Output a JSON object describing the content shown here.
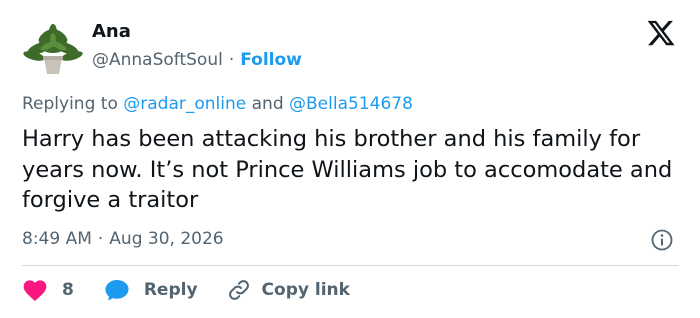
{
  "author": {
    "name": "Ana",
    "handle": "@AnnaSoftSoul",
    "separator": "·",
    "follow_label": "Follow"
  },
  "reply_context": {
    "prefix": "Replying to",
    "mention_1": "@radar_online",
    "conjunction": "and",
    "mention_2": "@Bella514678"
  },
  "tweet": {
    "text": "Harry has been attacking his brother and his family for years now. It’s not Prince Williams job to accomodate and forgive a traitor",
    "time": "8:49 AM",
    "separator": "·",
    "date": "Aug 30, 2026"
  },
  "actions": {
    "like_count": "8",
    "reply_label": "Reply",
    "copy_label": "Copy link"
  },
  "colors": {
    "accent": "#1d9bf0",
    "like": "#f91880",
    "muted": "#536471",
    "text": "#0f1419"
  },
  "icons": {
    "logo": "x-logo-icon",
    "info": "info-icon",
    "like": "heart-icon",
    "reply": "speech-bubble-icon",
    "copy": "link-icon"
  }
}
